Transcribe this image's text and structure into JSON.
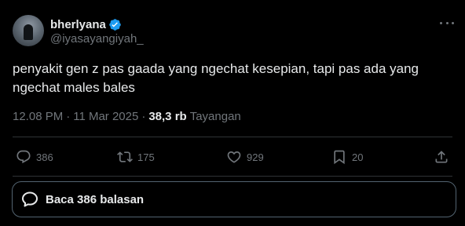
{
  "user": {
    "display_name": "bherlyana",
    "handle": "@iyasayangiyah_",
    "verified": true,
    "verified_color": "#1d9bf0"
  },
  "tweet": {
    "text": "penyakit gen z pas gaada yang ngechat kesepian, tapi pas ada yang ngechat males bales",
    "time": "12.08 PM",
    "separator": "·",
    "date": "11 Mar 2025",
    "views_count": "38,3 rb",
    "views_label": "Tayangan"
  },
  "actions": {
    "reply_count": "386",
    "retweet_count": "175",
    "like_count": "929",
    "bookmark_count": "20",
    "icons": [
      "reply-icon",
      "retweet-icon",
      "like-icon",
      "bookmark-icon",
      "share-icon"
    ]
  },
  "replies_button": {
    "label": "Baca 386 balasan",
    "icon": "speech-bubble-icon"
  },
  "colors": {
    "background": "#000000",
    "text": "#e7e9ea",
    "muted": "#71767b",
    "border": "#2f3336"
  }
}
